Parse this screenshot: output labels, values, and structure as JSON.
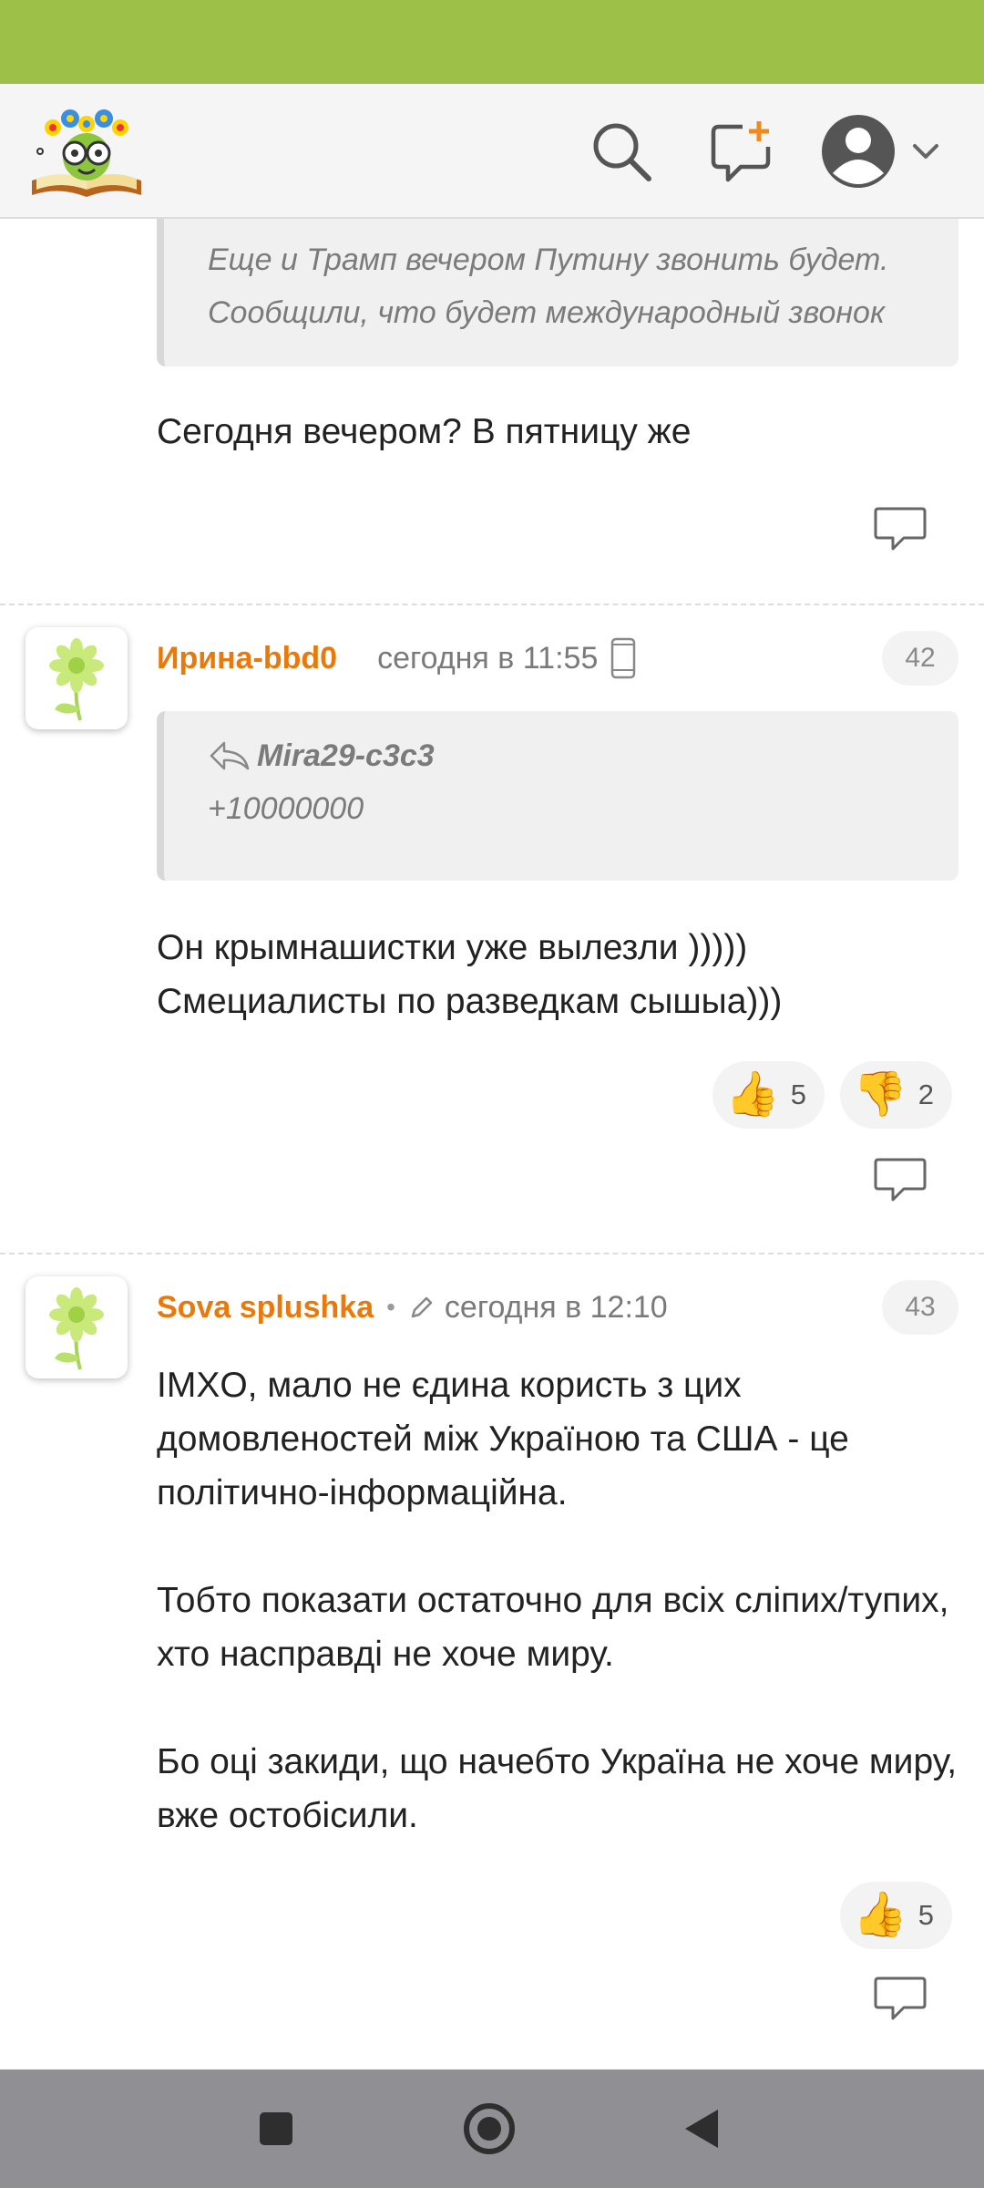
{
  "header": {
    "icons": [
      "logo",
      "search-icon",
      "new-message-icon",
      "user-avatar-icon",
      "chevron-down-icon"
    ]
  },
  "previous_comment": {
    "quote_text": "Еще и Трамп вечером Путину звонить будет. Сообщили, что будет международный звонок",
    "body": "Сегодня вечером? В пятницу же"
  },
  "comments": [
    {
      "author": "Ирина-bbd0",
      "time": "сегодня в 11:55",
      "number": "42",
      "quote_author": "Mira29-c3c3",
      "quote_text": "+10000000",
      "body": "Он крымнашистки уже вылезли )))))\nСмециалисты по разведкам сышыа)))",
      "likes": "5",
      "dislikes": "2"
    },
    {
      "author": "Sova splushka",
      "time": "сегодня в 12:10",
      "number": "43",
      "body": "IMXO, мало не єдина користь з цих домовленостей між Україною та США - це політично-інформаційна.\n\nТобто показати остаточно для всіх сліпих/тупих, хто насправді не хоче миру.\n\nБо оці закиди, що начебто Україна не хоче миру, вже остобісили.",
      "likes": "5"
    }
  ],
  "colors": {
    "status_bar": "#9dc049",
    "author": "#e8790d",
    "nav_bar": "#8f8f94"
  }
}
